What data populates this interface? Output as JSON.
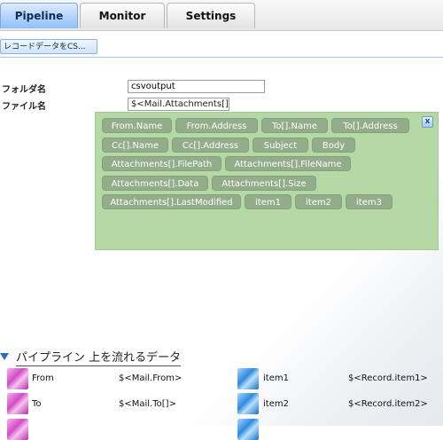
{
  "tabs": {
    "pipeline": "Pipeline",
    "monitor": "Monitor",
    "settings": "Settings"
  },
  "subtab": {
    "label": "レコードデータをCS..."
  },
  "form": {
    "folder_label": "フォルダ名",
    "folder_value": "csvoutput",
    "file_label": "ファイル名",
    "file_value": "$<Mail.Attachments[].l"
  },
  "token_panel": {
    "close": "x",
    "tokens": [
      "From.Name",
      "From.Address",
      "To[].Name",
      "To[].Address",
      "Cc[].Name",
      "Cc[].Address",
      "Subject",
      "Body",
      "Attachments[].FilePath",
      "Attachments[].FileName",
      "Attachments[].Data",
      "Attachments[].Size",
      "Attachments[].LastModified",
      "item1",
      "item2",
      "item3"
    ]
  },
  "pipeline_data": {
    "title": "パイプライン 上を流れるデータ",
    "rows": [
      {
        "left_label": "From",
        "left_value": "$<Mail.From>",
        "right_label": "item1",
        "right_value": "$<Record.item1>"
      },
      {
        "left_label": "To",
        "left_value": "$<Mail.To[]>",
        "right_label": "item2",
        "right_value": "$<Record.item2>"
      }
    ]
  },
  "colors": {
    "active_tab": "#8fc0f7",
    "panel_bg": "#b5d9a4",
    "token_bg": "#93ad8a",
    "accent_blue": "#2a6cc4"
  }
}
